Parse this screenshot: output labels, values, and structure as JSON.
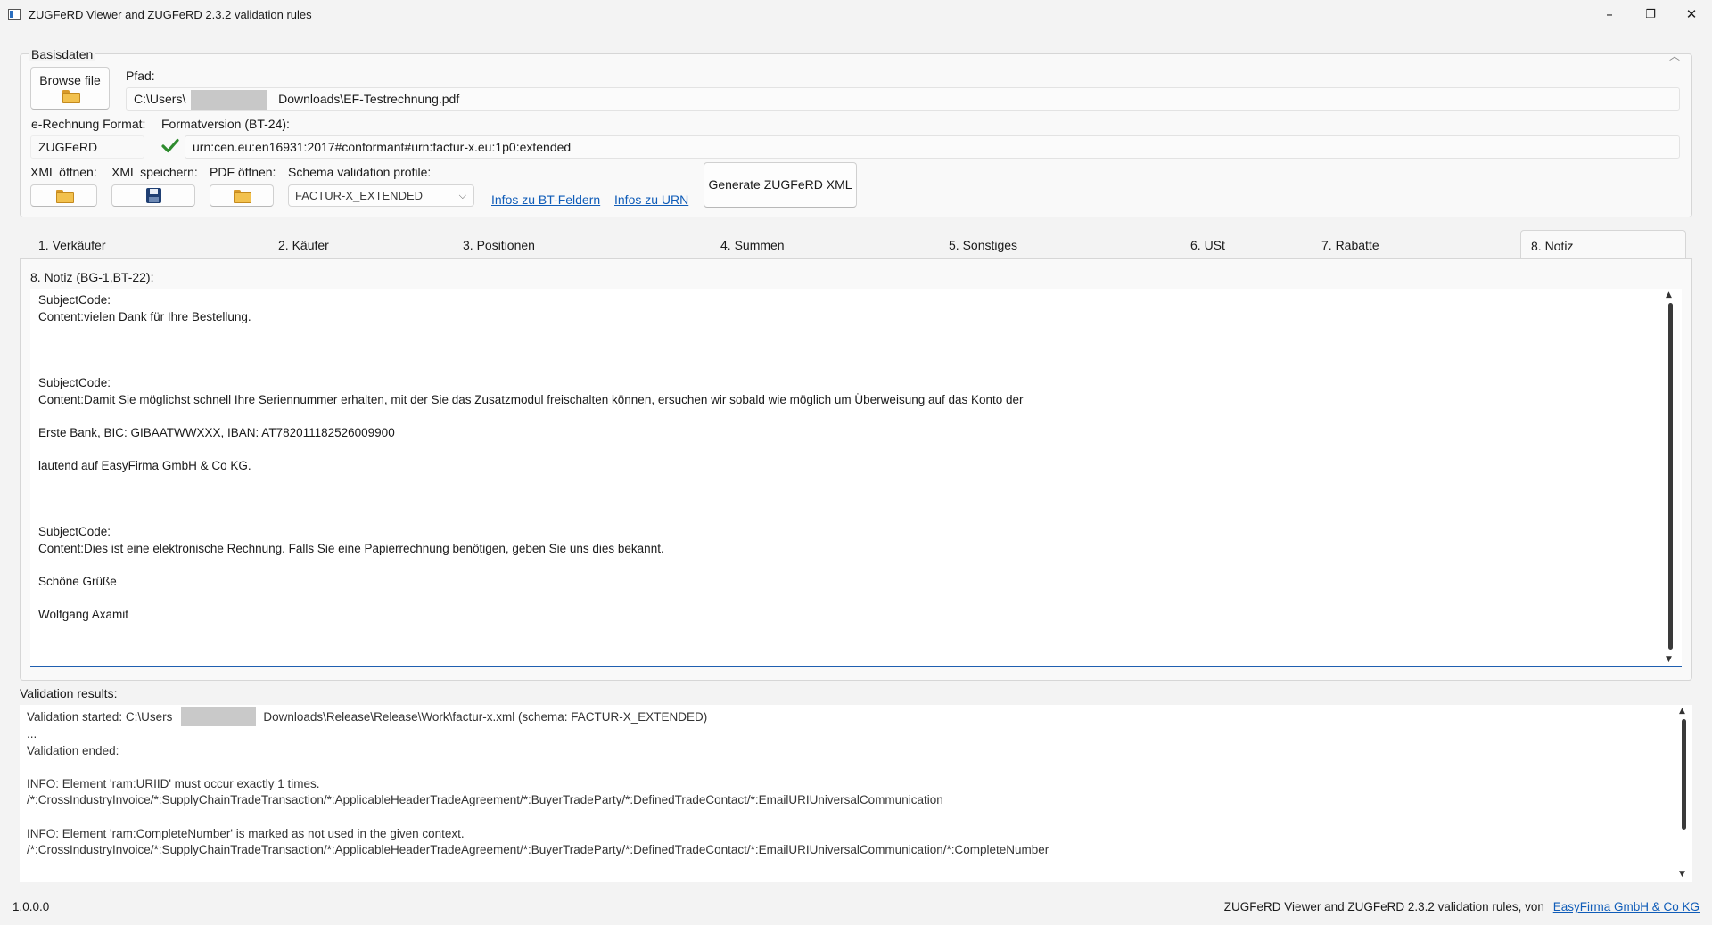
{
  "window": {
    "title": "ZUGFeRD Viewer and ZUGFeRD 2.3.2 validation rules",
    "controls": {
      "minimize": "–",
      "maximize": "❐",
      "close": "✕"
    }
  },
  "basisdaten": {
    "group_label": "Basisdaten",
    "browse_button": "Browse file",
    "pfad_label": "Pfad:",
    "pfad_prefix": "C:\\Users\\",
    "pfad_suffix": "Downloads\\EF-Testrechnung.pdf",
    "format_label": "e-Rechnung Format:",
    "format_value": "ZUGFeRD",
    "formatversion_label": "Formatversion (BT-24):",
    "formatversion_value": "urn:cen.eu:en16931:2017#conformant#urn:factur-x.eu:1p0:extended",
    "xml_open_label": "XML öffnen:",
    "xml_save_label": "XML speichern:",
    "pdf_open_label": "PDF öffnen:",
    "schema_label": "Schema validation profile:",
    "schema_value": "FACTUR-X_EXTENDED",
    "link_bt": "Infos zu BT-Feldern",
    "link_urn": "Infos zu URN",
    "generate_button": "Generate ZUGFeRD XML"
  },
  "tabs": [
    {
      "label": "1. Verkäufer"
    },
    {
      "label": "2. Käufer"
    },
    {
      "label": "3. Positionen"
    },
    {
      "label": "4. Summen"
    },
    {
      "label": "5. Sonstiges"
    },
    {
      "label": "6. USt"
    },
    {
      "label": "7. Rabatte"
    },
    {
      "label": "8. Notiz",
      "active": true
    }
  ],
  "notiz": {
    "label": "8. Notiz (BG-1,BT-22):",
    "content": "SubjectCode:\nContent:vielen Dank für Ihre Bestellung.\n\n\n\nSubjectCode:\nContent:Damit Sie möglichst schnell Ihre Seriennummer erhalten, mit der Sie das Zusatzmodul freischalten können, ersuchen wir sobald wie möglich um Überweisung auf das Konto der\n\nErste Bank, BIC: GIBAATWWXXX, IBAN: AT782011182526009900\n\nlautend auf EasyFirma GmbH & Co KG.\n\n\n\nSubjectCode:\nContent:Dies ist eine elektronische Rechnung. Falls Sie eine Papierrechnung benötigen, geben Sie uns dies bekannt.\n\nSchöne Grüße\n\nWolfgang Axamit"
  },
  "validation": {
    "label": "Validation results:",
    "line1_prefix": "Validation started: C:\\Users",
    "line1_suffix": "Downloads\\Release\\Release\\Work\\factur-x.xml (schema: FACTUR-X_EXTENDED)",
    "rest": "...\nValidation ended:\n\nINFO: Element 'ram:URIID' must occur exactly 1 times.\n/*:CrossIndustryInvoice/*:SupplyChainTradeTransaction/*:ApplicableHeaderTradeAgreement/*:BuyerTradeParty/*:DefinedTradeContact/*:EmailURIUniversalCommunication\n\nINFO: Element 'ram:CompleteNumber' is marked as not used in the given context.\n/*:CrossIndustryInvoice/*:SupplyChainTradeTransaction/*:ApplicableHeaderTradeAgreement/*:BuyerTradeParty/*:DefinedTradeContact/*:EmailURIUniversalCommunication/*:CompleteNumber"
  },
  "status": {
    "version": "1.0.0.0",
    "footer_text": "ZUGFeRD Viewer and ZUGFeRD 2.3.2 validation rules, von",
    "footer_link": "EasyFirma GmbH & Co KG"
  }
}
